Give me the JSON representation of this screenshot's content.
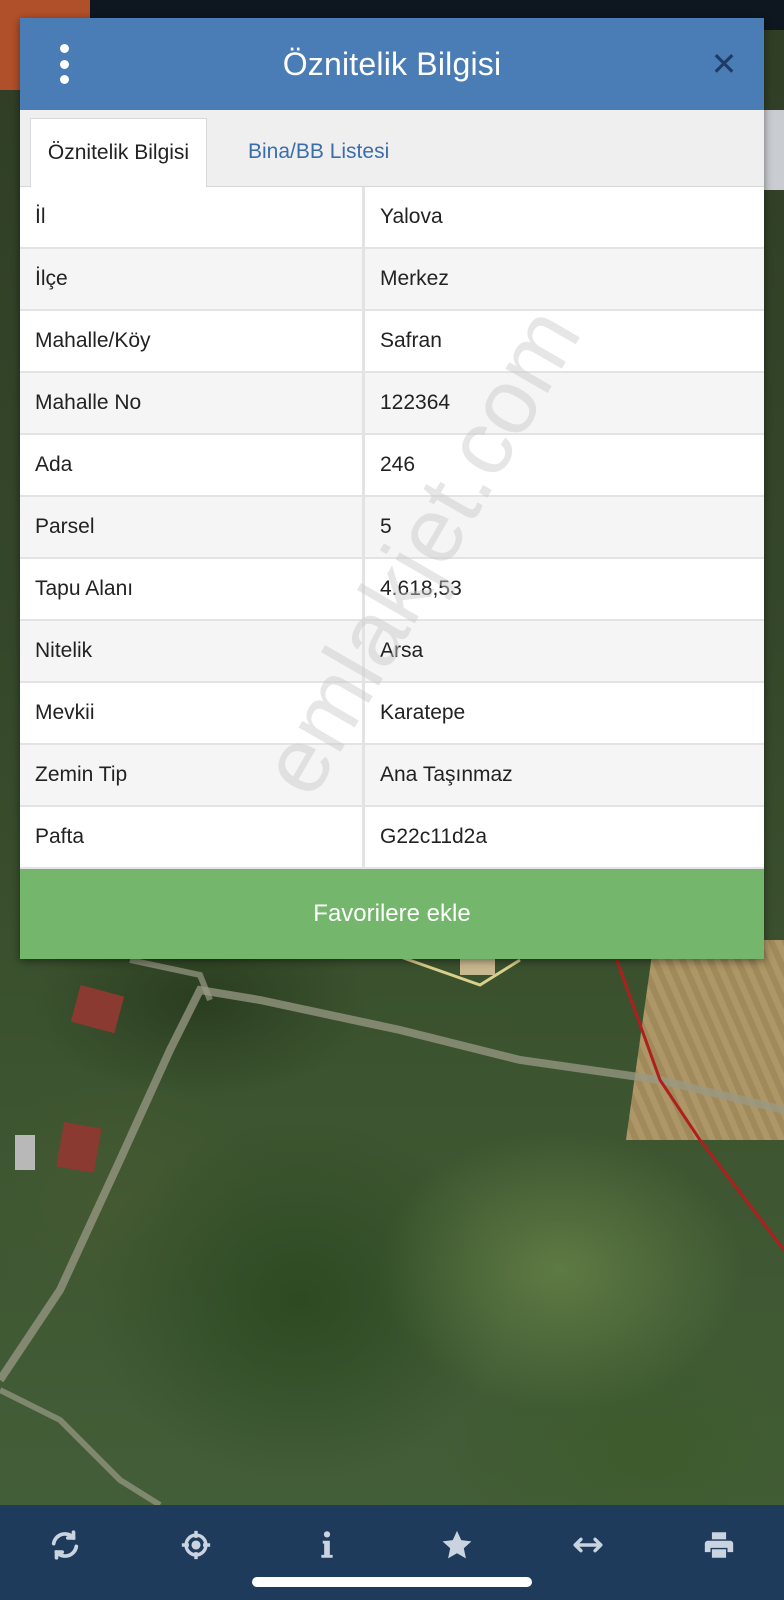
{
  "modal": {
    "title": "Öznitelik Bilgisi",
    "tabs": [
      {
        "label": "Öznitelik Bilgisi",
        "active": true
      },
      {
        "label": "Bina/BB Listesi",
        "active": false
      }
    ],
    "rows": [
      {
        "key": "İl",
        "value": "Yalova"
      },
      {
        "key": "İlçe",
        "value": "Merkez"
      },
      {
        "key": "Mahalle/Köy",
        "value": "Safran"
      },
      {
        "key": "Mahalle No",
        "value": "122364"
      },
      {
        "key": "Ada",
        "value": "246"
      },
      {
        "key": "Parsel",
        "value": "5"
      },
      {
        "key": "Tapu Alanı",
        "value": "4.618,53"
      },
      {
        "key": "Nitelik",
        "value": "Arsa"
      },
      {
        "key": "Mevkii",
        "value": "Karatepe"
      },
      {
        "key": "Zemin Tip",
        "value": "Ana Taşınmaz"
      },
      {
        "key": "Pafta",
        "value": "G22c11d2a"
      }
    ],
    "favorite_button_label": "Favorilere ekle"
  },
  "watermark": "emlakjet.com",
  "toolbar": {
    "icons": [
      "refresh-icon",
      "crosshair-icon",
      "info-icon",
      "star-icon",
      "measure-icon",
      "print-icon"
    ]
  },
  "colors": {
    "header": "#4a7cb6",
    "close": "#1f3a66",
    "favorite": "#74b66b",
    "toolbar": "#1f3b5c",
    "tab_link": "#3b6ea8"
  }
}
